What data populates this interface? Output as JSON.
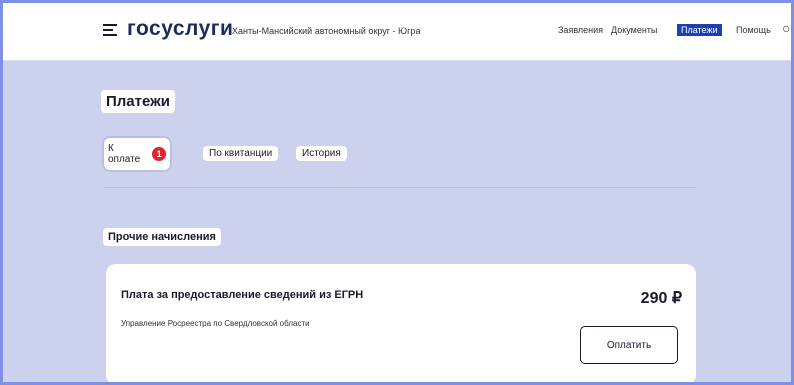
{
  "header": {
    "logo": "госуслуги",
    "region": "Ханты-Мансийский автономный округ - Югра",
    "nav": [
      "Заявления",
      "Документы",
      "Платежи",
      "Помощь"
    ],
    "active_nav_index": 2,
    "burger_icon": "menu-icon",
    "search_icon": "search-icon"
  },
  "page": {
    "title": "Платежи"
  },
  "tabs": [
    {
      "label": "К оплате",
      "badge": "1"
    },
    {
      "label": "По квитанции"
    },
    {
      "label": "История"
    }
  ],
  "section": {
    "title": "Прочие начисления"
  },
  "charge": {
    "title": "Плата за предоставление сведений из ЕГРН",
    "provider": "Управление Росреестра по Свердловской области",
    "amount": "290 ₽",
    "pay_label": "Оплатить"
  },
  "colors": {
    "page_bg": "#ccd1ee",
    "active_nav_bg": "#1d3fb4",
    "badge": "#e0242b"
  }
}
